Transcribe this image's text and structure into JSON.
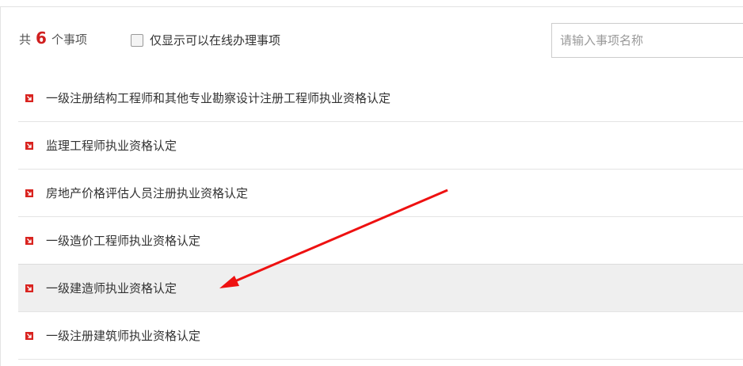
{
  "header": {
    "count_prefix": "共",
    "count_value": "6",
    "count_suffix": "个事项",
    "filter_label": "仅显示可以在线办理事项",
    "search_placeholder": "请输入事项名称"
  },
  "items": [
    {
      "label": "一级注册结构工程师和其他专业勘察设计注册工程师执业资格认定"
    },
    {
      "label": "监理工程师执业资格认定"
    },
    {
      "label": "房地产价格评估人员注册执业资格认定"
    },
    {
      "label": "一级造价工程师执业资格认定"
    },
    {
      "label": "一级建造师执业资格认定"
    },
    {
      "label": "一级注册建筑师执业资格认定"
    }
  ],
  "colors": {
    "accent": "#d9231f",
    "annotation_arrow": "#ee1111",
    "hover_row": "#efefef"
  },
  "icons": {
    "item_bullet": "red-arrow-square-icon",
    "filter": "checkbox-icon"
  }
}
